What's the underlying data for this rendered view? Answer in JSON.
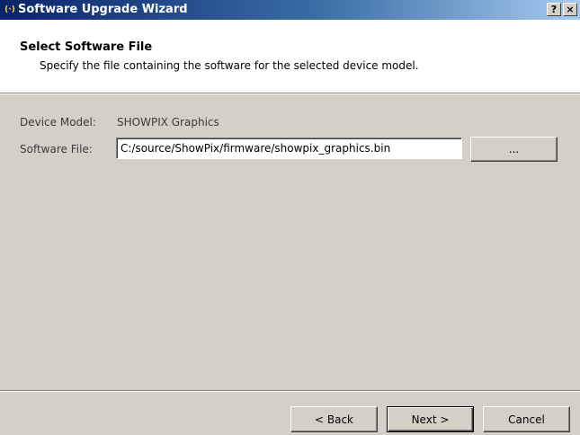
{
  "window": {
    "icon": "(·)",
    "title": "Software Upgrade Wizard",
    "help_label": "?",
    "close_label": "×"
  },
  "header": {
    "title": "Select Software File",
    "subtitle": "Specify the file containing the software for the selected device model."
  },
  "form": {
    "device_model_label": "Device Model:",
    "device_model_value": "SHOWPIX Graphics",
    "software_file_label": "Software File:",
    "software_file_value": "C:/source/ShowPix/firmware/showpix_graphics.bin",
    "browse_label": "..."
  },
  "footer": {
    "back_label": "< Back",
    "next_label": "Next >",
    "cancel_label": "Cancel"
  }
}
